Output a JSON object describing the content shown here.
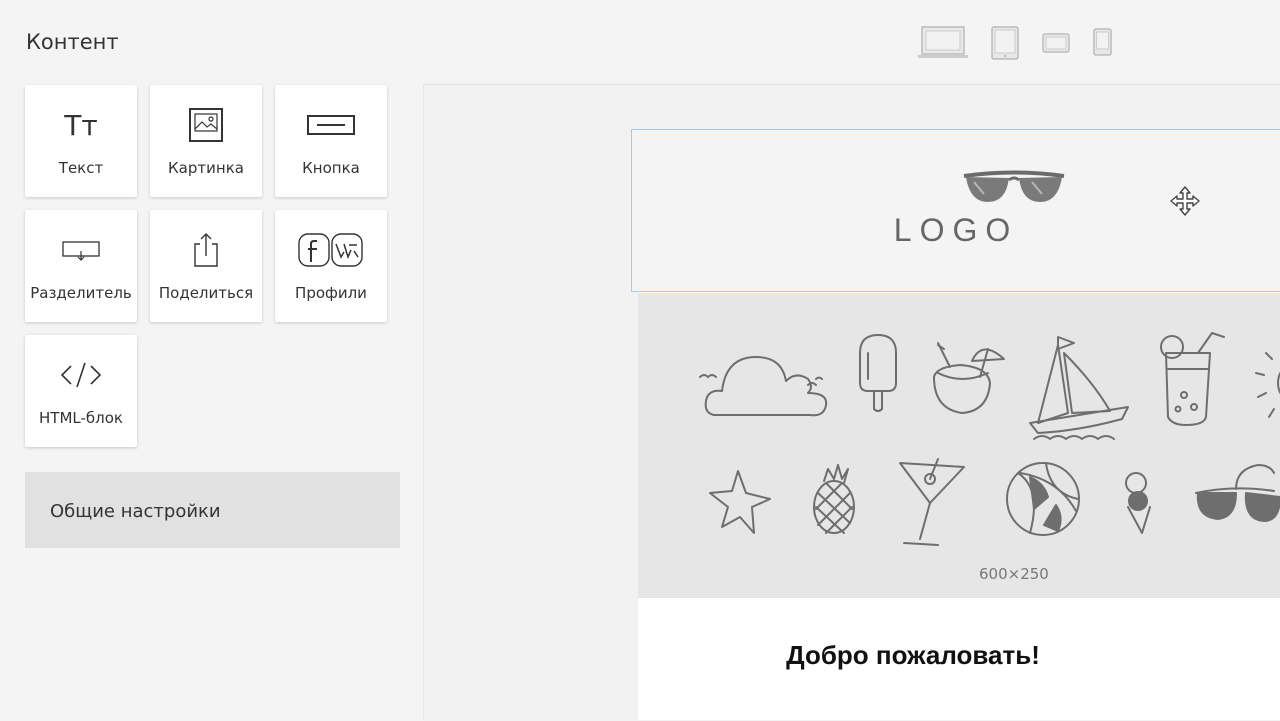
{
  "sidebar": {
    "title": "Контент",
    "blocks": [
      {
        "label": "Текст",
        "icon": "text-icon",
        "glyph": "Tт"
      },
      {
        "label": "Картинка",
        "icon": "image-icon"
      },
      {
        "label": "Кнопка",
        "icon": "button-icon"
      },
      {
        "label": "Разделитель",
        "icon": "divider-icon"
      },
      {
        "label": "Поделиться",
        "icon": "share-icon"
      },
      {
        "label": "Профили",
        "icon": "social-profiles-icon"
      },
      {
        "label": "HTML-блок",
        "icon": "code-icon"
      }
    ],
    "settings_label": "Общие настройки"
  },
  "devices": [
    "desktop-icon",
    "tablet-portrait-icon",
    "tablet-landscape-icon",
    "mobile-icon"
  ],
  "email": {
    "logo_text": "LOGO",
    "banner_size": "600×250",
    "welcome_title": "Добро пожаловать!"
  },
  "colors": {
    "selection_border": "#9bcdf2",
    "settings_bg": "#e1e1e1",
    "banner_bg": "#e6e6e6",
    "doodle_stroke": "#6e6e6e"
  }
}
